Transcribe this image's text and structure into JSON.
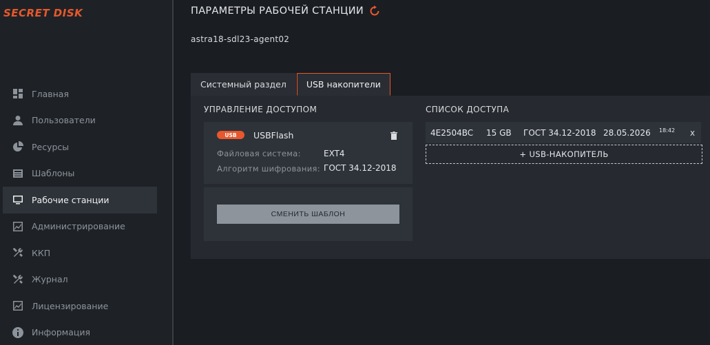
{
  "app": {
    "logo": "SECRET DISK"
  },
  "colors": {
    "accent": "#e8582c",
    "sidebar_bg": "#1e2227",
    "panel_bg": "#262a30",
    "card_bg": "#2e333a"
  },
  "sidebar": {
    "items": [
      {
        "label": "Главная",
        "icon": "dashboard-icon"
      },
      {
        "label": "Пользователи",
        "icon": "user-icon"
      },
      {
        "label": "Ресурсы",
        "icon": "pie-chart-icon"
      },
      {
        "label": "Шаблоны",
        "icon": "template-icon"
      },
      {
        "label": "Рабочие станции",
        "icon": "monitor-icon",
        "active": true
      },
      {
        "label": "Администрирование",
        "icon": "activity-chart-icon"
      },
      {
        "label": "ККП",
        "icon": "tools-icon"
      },
      {
        "label": "Журнал",
        "icon": "tools-icon"
      },
      {
        "label": "Лицензирование",
        "icon": "activity-chart-icon"
      },
      {
        "label": "Информация",
        "icon": "info-icon"
      }
    ]
  },
  "header": {
    "title": "ПАРАМЕТРЫ РАБОЧЕЙ СТАНЦИИ",
    "hostname": "astra18-sdl23-agent02"
  },
  "tabs": [
    {
      "label": "Системный раздел",
      "active": false
    },
    {
      "label": "USB накопители",
      "active": true
    }
  ],
  "access_control": {
    "title": "УПРАВЛЕНИЕ ДОСТУПОМ",
    "device": {
      "badge": "USB",
      "name": "USBFlash",
      "fs_label": "Файловая система:",
      "fs_value": "EXT4",
      "algo_label": "Алгоритм шифрования:",
      "algo_value": "ГОСТ 34.12-2018"
    },
    "change_template_label": "СМЕНИТЬ ШАБЛОН"
  },
  "access_list": {
    "title": "СПИСОК ДОСТУПА",
    "rows": [
      {
        "id": "4E2504BC",
        "size": "15 GB",
        "algo": "ГОСТ 34.12-2018",
        "date": "28.05.2026",
        "time": "18:42",
        "remove": "x"
      }
    ],
    "add_label": "+ USB-НАКОПИТЕЛЬ"
  }
}
